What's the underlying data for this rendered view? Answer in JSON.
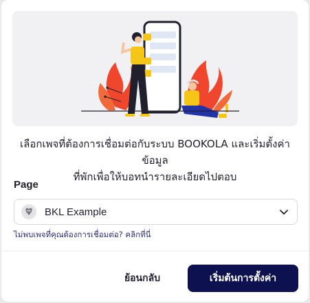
{
  "description": {
    "line1": "เลือกเพจที่ต้องการเชื่อมต่อกับระบบ BOOKOLA และเริ่มตั้งค่าข้อมูล",
    "line2": "ที่พักเพื่อให้บอทนำรายละเอียดไปตอบ"
  },
  "page_field": {
    "label": "Page",
    "selected_value": "BKL Example"
  },
  "help_link": "ไม่พบเพจที่คุณต้องการเชื่อมต่อ? คลิกที่นี่",
  "buttons": {
    "back": "ย้อนกลับ",
    "start": "เริ่มต้นการตั้งค่า"
  },
  "colors": {
    "primary": "#0d1150",
    "accent_red": "#f0462d",
    "accent_yellow": "#f5c518",
    "link": "#2b2b7a"
  },
  "icons": {
    "page_avatar": "bkl-logo-icon",
    "dropdown": "chevron-down-icon"
  }
}
